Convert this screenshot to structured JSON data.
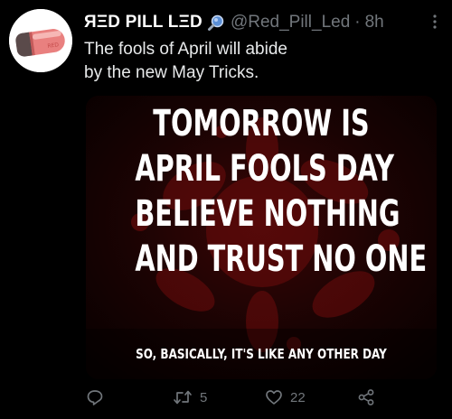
{
  "tweet": {
    "display_name": "ЯΞD PILL LΞD",
    "handle": "@Red_Pill_Led",
    "separator": "·",
    "timestamp": "8h",
    "text_lines": [
      "The fools of April will abide",
      "by the new May Tricks."
    ],
    "avatar_icon": "red-pill-capsule"
  },
  "media": {
    "meme_lines": [
      "TOMORROW IS",
      "APRIL FOOLS DAY",
      "BELIEVE NOTHING",
      "AND TRUST NO ONE"
    ],
    "meme_caption": "SO, BASICALLY, IT'S LIKE ANY OTHER DAY"
  },
  "actions": {
    "reply": {
      "icon": "reply-icon",
      "count": ""
    },
    "retweet": {
      "icon": "retweet-icon",
      "count": "5"
    },
    "like": {
      "icon": "heart-icon",
      "count": "22"
    },
    "share": {
      "icon": "share-icon",
      "count": ""
    }
  },
  "colors": {
    "background": "#000000",
    "text": "#e7e9ea",
    "muted": "#71767b",
    "meme_background": "#1a0303",
    "meme_accent": "#8a1010"
  }
}
